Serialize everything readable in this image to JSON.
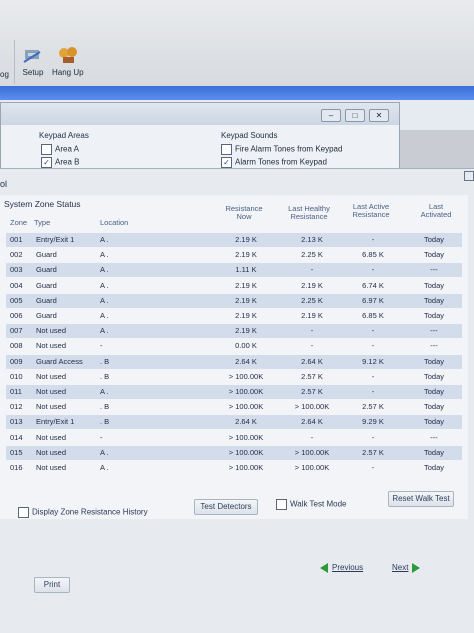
{
  "toolbar": {
    "left_fragment": "og",
    "setup_label": "Setup",
    "hangup_label": "Hang Up"
  },
  "keypad": {
    "areas_title": "Keypad Areas",
    "area_a": "Area A",
    "area_b": "Area B",
    "sounds_title": "Keypad Sounds",
    "fire_tones": "Fire Alarm Tones from Keypad",
    "alarm_tones": "Alarm Tones from Keypad"
  },
  "main": {
    "title_fragment": "ol",
    "section_title": "System Zone Status",
    "headers": {
      "zone": "Zone",
      "type": "Type",
      "location": "Location",
      "resistance": "Resistance Now",
      "last_healthy": "Last Healthy Resistance",
      "last_active": "Last Active Resistance",
      "last_activated": "Last Activated"
    },
    "rows": [
      {
        "zone": "001",
        "type": "Entry/Exit 1",
        "location": "A .",
        "res": "2.19 K",
        "lh": "2.13 K",
        "la": "-",
        "lac": "Today"
      },
      {
        "zone": "002",
        "type": "Guard",
        "location": "A .",
        "res": "2.19 K",
        "lh": "2.25 K",
        "la": "6.85 K",
        "lac": "Today"
      },
      {
        "zone": "003",
        "type": "Guard",
        "location": "A .",
        "res": "1.11 K",
        "lh": "-",
        "la": "-",
        "lac": "---"
      },
      {
        "zone": "004",
        "type": "Guard",
        "location": "A .",
        "res": "2.19 K",
        "lh": "2.19 K",
        "la": "6.74 K",
        "lac": "Today"
      },
      {
        "zone": "005",
        "type": "Guard",
        "location": "A .",
        "res": "2.19 K",
        "lh": "2.25 K",
        "la": "6.97 K",
        "lac": "Today"
      },
      {
        "zone": "006",
        "type": "Guard",
        "location": "A .",
        "res": "2.19 K",
        "lh": "2.19 K",
        "la": "6.85 K",
        "lac": "Today"
      },
      {
        "zone": "007",
        "type": "Not used",
        "location": "A .",
        "res": "2.19 K",
        "lh": "-",
        "la": "-",
        "lac": "---"
      },
      {
        "zone": "008",
        "type": "Not used",
        "location": "-",
        "res": "0.00 K",
        "lh": "-",
        "la": "-",
        "lac": "---"
      },
      {
        "zone": "009",
        "type": "Guard Access",
        "location": ". B",
        "res": "2.64 K",
        "lh": "2.64 K",
        "la": "9.12 K",
        "lac": "Today"
      },
      {
        "zone": "010",
        "type": "Not used",
        "location": ". B",
        "res": "> 100.00K",
        "lh": "2.57 K",
        "la": "-",
        "lac": "Today"
      },
      {
        "zone": "011",
        "type": "Not used",
        "location": "A .",
        "res": "> 100.00K",
        "lh": "2.57 K",
        "la": "-",
        "lac": "Today"
      },
      {
        "zone": "012",
        "type": "Not used",
        "location": ". B",
        "res": "> 100.00K",
        "lh": "> 100.00K",
        "la": "2.57 K",
        "lac": "Today"
      },
      {
        "zone": "013",
        "type": "Entry/Exit 1",
        "location": ". B",
        "res": "2.64 K",
        "lh": "2.64 K",
        "la": "9.29 K",
        "lac": "Today"
      },
      {
        "zone": "014",
        "type": "Not used",
        "location": "-",
        "res": "> 100.00K",
        "lh": "-",
        "la": "-",
        "lac": "---"
      },
      {
        "zone": "015",
        "type": "Not used",
        "location": "A .",
        "res": "> 100.00K",
        "lh": "> 100.00K",
        "la": "2.57 K",
        "lac": "Today"
      },
      {
        "zone": "016",
        "type": "Not used",
        "location": "A .",
        "res": "> 100.00K",
        "lh": "> 100.00K",
        "la": "-",
        "lac": "Today"
      }
    ],
    "display_history": "Display Zone Resistance History",
    "test_detectors": "Test Detectors",
    "walk_test_mode": "Walk Test Mode",
    "reset_walk_test": "Reset Walk Test",
    "previous": "Previous",
    "next": "Next",
    "print": "Print"
  }
}
